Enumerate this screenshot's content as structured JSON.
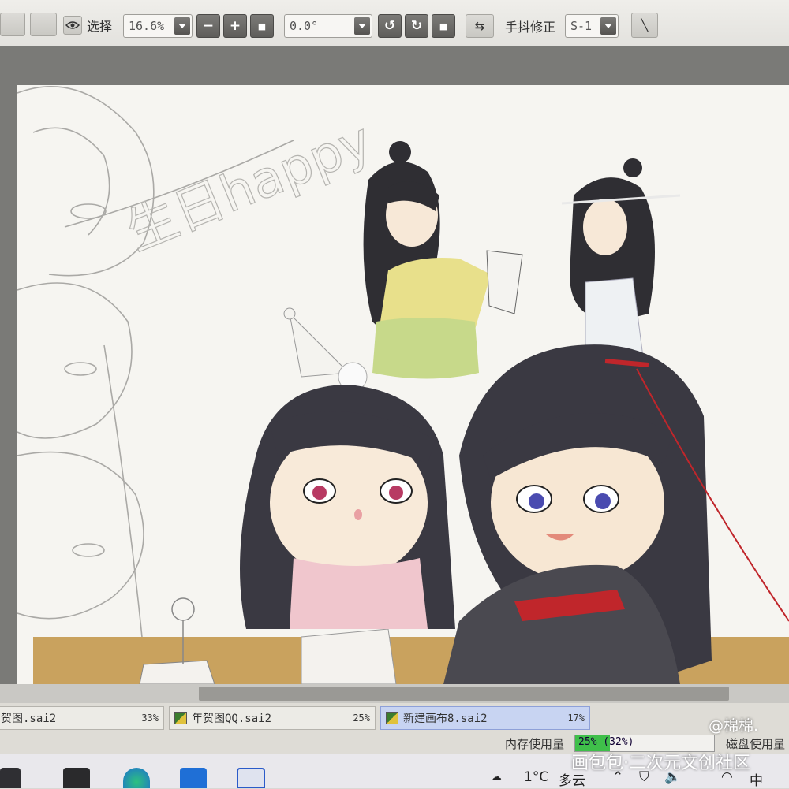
{
  "toolbar": {
    "select_label": "选择",
    "zoom_value": "16.6%",
    "zoom_minus": "−",
    "zoom_plus": "+",
    "zoom_reset": "■",
    "rotation_value": "0.0°",
    "rotate_ccw": "↺",
    "rotate_cw": "↻",
    "rotate_reset": "■",
    "flip": "⇆",
    "stabilizer_label": "手抖修正",
    "stabilizer_value": "S-1",
    "line_tool": "╲"
  },
  "canvas": {
    "sketch_text": "生日happy"
  },
  "tabs": [
    {
      "name": "贺图.sai2",
      "zoom": "33%",
      "active": false
    },
    {
      "name": "年贺图QQ.sai2",
      "zoom": "25%",
      "active": false
    },
    {
      "name": "新建画布8.sai2",
      "zoom": "17%",
      "active": true
    }
  ],
  "status": {
    "memory_label": "内存使用量",
    "memory_text": "25% (32%)",
    "memory_fraction": 0.25,
    "disk_label": "磁盘使用量"
  },
  "taskbar": {
    "temperature": "1°C",
    "weather": "多云",
    "ime": "中",
    "tray_icons": [
      "chevron-up-icon",
      "shield-icon",
      "volume-icon",
      "wifi-icon",
      "keyboard-icon"
    ]
  },
  "overlay": {
    "credit": "@棉棉.",
    "source": "画包包·二次元文创社区"
  },
  "colors": {
    "canvas_bg": "#f6f5f1",
    "workspace_bg": "#7a7a77",
    "active_tab": "#c8d4f2",
    "memory_fill": "#3fbf4a",
    "table_wood": "#c9a25e",
    "accent_red": "#c0262b"
  }
}
